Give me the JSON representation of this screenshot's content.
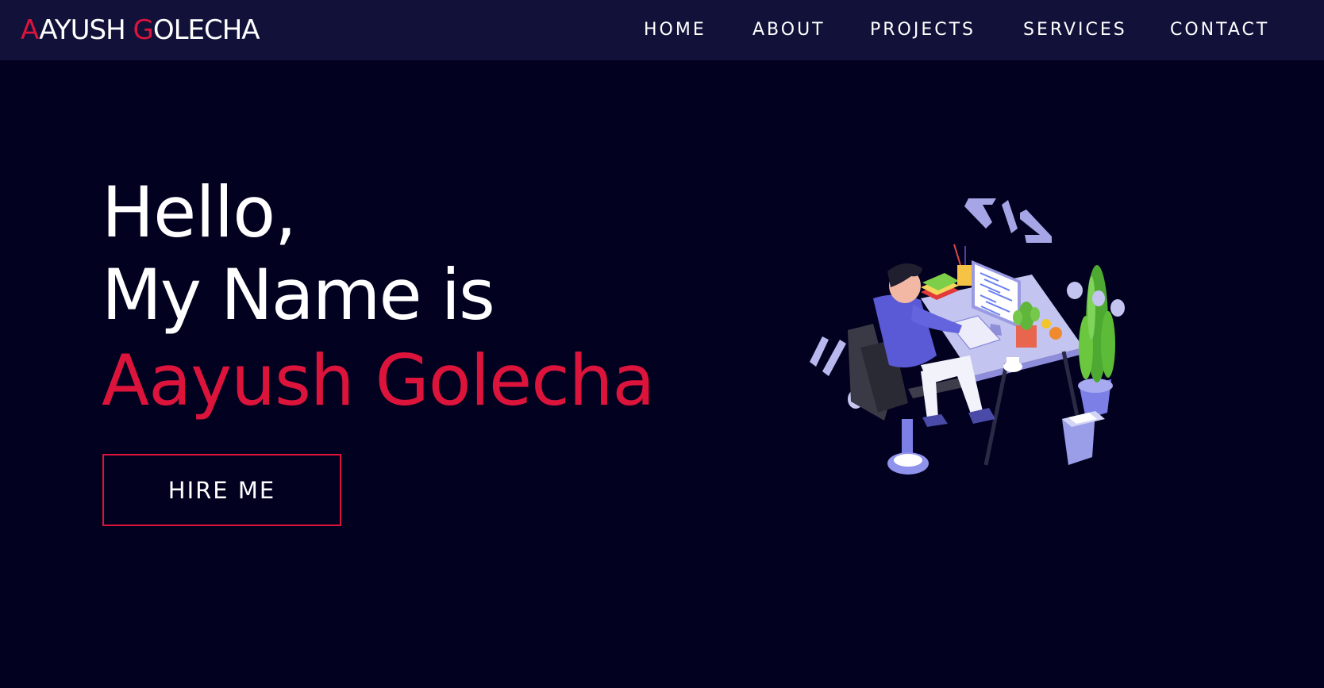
{
  "navbar": {
    "logo": {
      "first_initial": "A",
      "first_rest": "AYUSH ",
      "last_initial": "G",
      "last_rest": "OLECHA"
    },
    "links": [
      "HOME",
      "ABOUT",
      "PROJECTS",
      "SERVICES",
      "CONTACT"
    ]
  },
  "hero": {
    "line_1": "Hello,",
    "line_2": "My Name is",
    "line_3": "Aayush Golecha",
    "button_label": "HIRE ME"
  },
  "colors": {
    "background": "#020120",
    "navbar": "#11113a",
    "accent": "#dc143c",
    "text": "#ffffff"
  },
  "illustration": {
    "icon": "developer-at-desk-illustration",
    "code_symbol": "code-tag-icon"
  }
}
